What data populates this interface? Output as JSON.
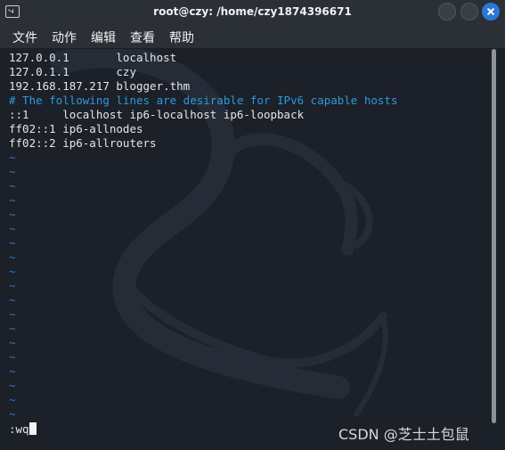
{
  "window": {
    "title": "root@czy: /home/czy1874396671"
  },
  "menu": {
    "items": [
      "文件",
      "动作",
      "编辑",
      "查看",
      "帮助"
    ]
  },
  "terminal": {
    "lines": [
      {
        "text": "127.0.0.1       localhost",
        "style": "normal"
      },
      {
        "text": "127.0.1.1       czy",
        "style": "normal"
      },
      {
        "text": "192.168.187.217 blogger.thm",
        "style": "normal"
      },
      {
        "text": "# The following lines are desirable for IPv6 capable hosts",
        "style": "comment"
      },
      {
        "text": "::1     localhost ip6-localhost ip6-loopback",
        "style": "normal"
      },
      {
        "text": "ff02::1 ip6-allnodes",
        "style": "normal"
      },
      {
        "text": "ff02::2 ip6-allrouters",
        "style": "normal"
      }
    ],
    "empty_line_marker": "~",
    "empty_line_count": 19,
    "command_line": ":wq"
  },
  "watermark": "CSDN @芝士土包鼠",
  "colors": {
    "background": "#1b2029",
    "text": "#e6e6e6",
    "comment": "#2e9ad9",
    "tilde": "#3274c4",
    "close_button": "#2a78d6"
  }
}
